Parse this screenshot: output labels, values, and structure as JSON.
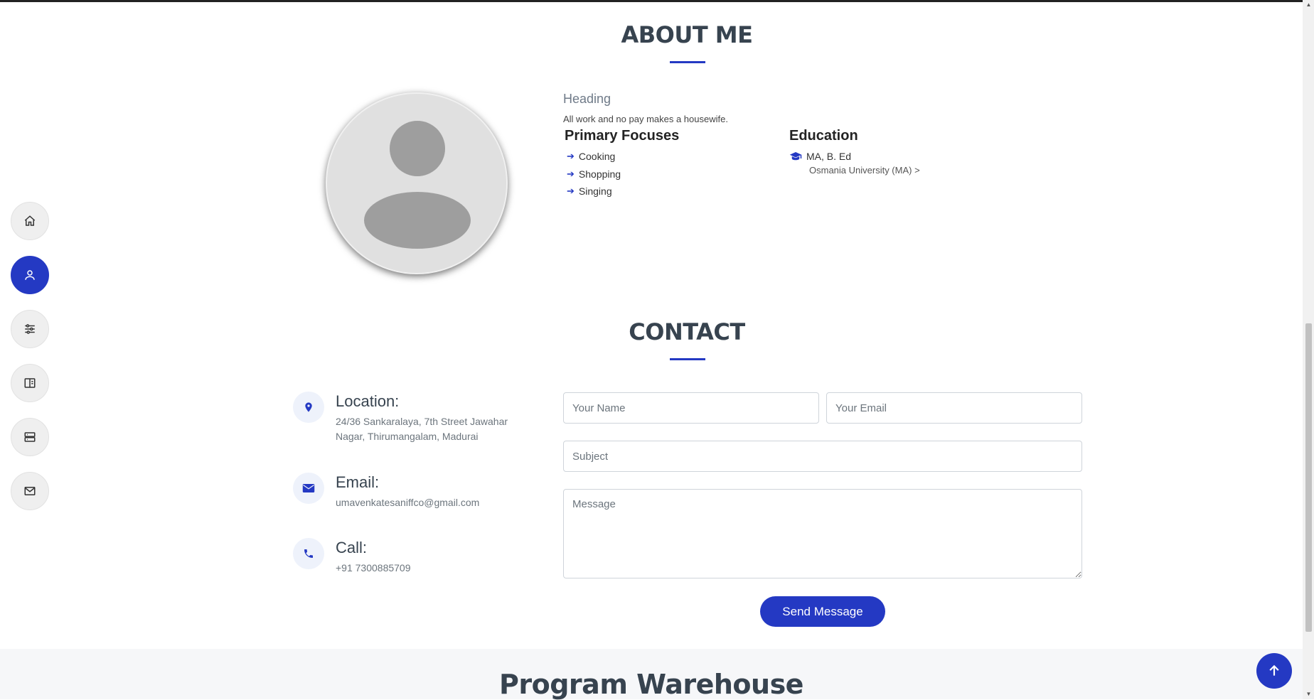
{
  "about": {
    "title": "ABOUT ME",
    "heading": "Heading",
    "description": "All work and no pay makes a housewife.",
    "focuses_title": "Primary Focuses",
    "focuses": [
      "Cooking",
      "Shopping",
      "Singing"
    ],
    "education_title": "Education",
    "education_degree": "MA, B. Ed",
    "education_school": "Osmania University (MA) >"
  },
  "contact": {
    "title": "CONTACT",
    "location_title": "Location:",
    "location_text": "24/36 Sankaralaya, 7th Street Jawahar Nagar, Thirumangalam, Madurai",
    "email_title": "Email:",
    "email_text": "umavenkatesaniffco@gmail.com",
    "call_title": "Call:",
    "call_text": "+91 7300885709",
    "form": {
      "name_placeholder": "Your Name",
      "email_placeholder": "Your Email",
      "subject_placeholder": "Subject",
      "message_placeholder": "Message",
      "send_label": "Send Message"
    }
  },
  "next_section": {
    "title": "Program Warehouse"
  },
  "sidenav": {
    "items": [
      {
        "icon": "home-icon",
        "active": false
      },
      {
        "icon": "user-icon",
        "active": true
      },
      {
        "icon": "sliders-icon",
        "active": false
      },
      {
        "icon": "book-icon",
        "active": false
      },
      {
        "icon": "server-icon",
        "active": false
      },
      {
        "icon": "envelope-icon",
        "active": false
      }
    ]
  },
  "colors": {
    "accent": "#2439c3",
    "heading": "#37434f"
  }
}
